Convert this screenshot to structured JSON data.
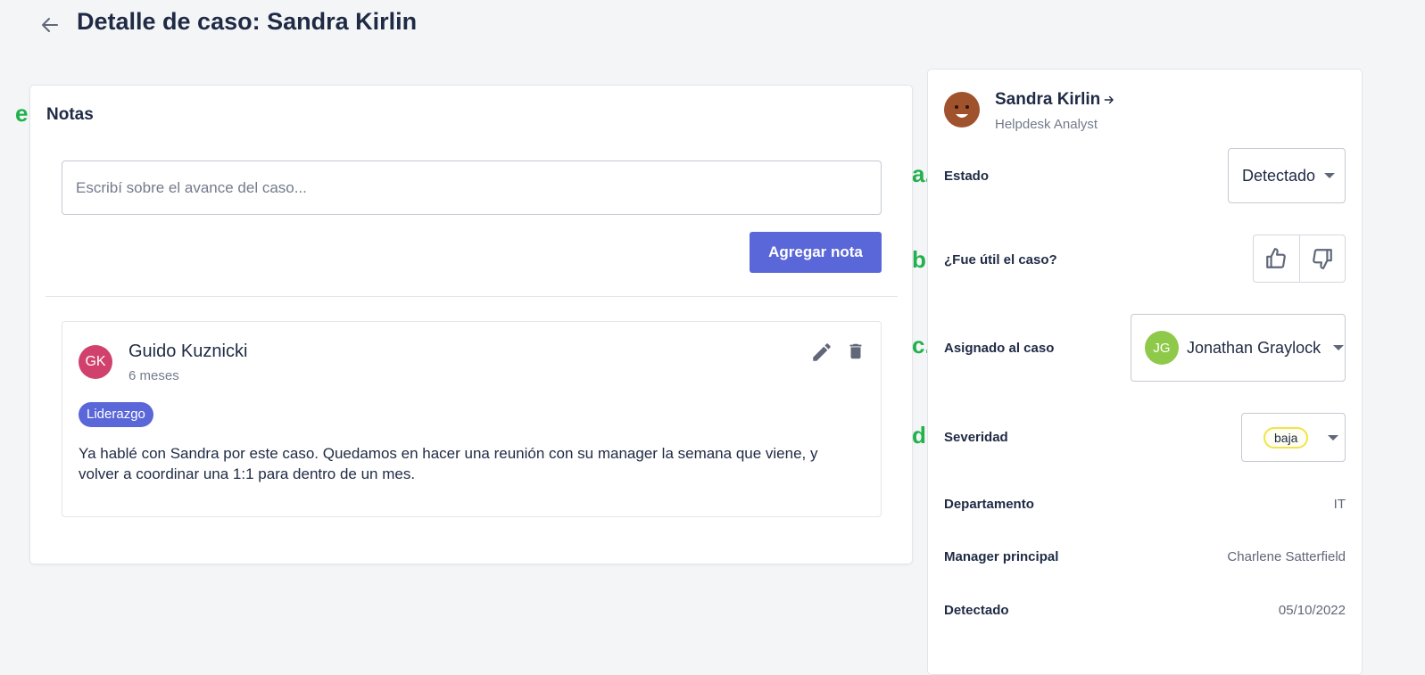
{
  "header": {
    "title": "Detalle de caso: Sandra Kirlin"
  },
  "annotations": {
    "a": "a.",
    "b": "b.",
    "c": "c.",
    "d": "d.",
    "e": "e."
  },
  "notes": {
    "title": "Notas",
    "input_placeholder": "Escribí sobre el avance del caso...",
    "add_button": "Agregar nota",
    "items": [
      {
        "initials": "GK",
        "author": "Guido Kuznicki",
        "time": "6 meses",
        "tag": "Liderazgo",
        "body": "Ya hablé con Sandra por este caso. Quedamos en hacer una reunión con su manager la semana que viene, y volver a coordinar una 1:1 para dentro de un mes."
      }
    ]
  },
  "sidebar": {
    "person": {
      "name": "Sandra Kirlin",
      "role": "Helpdesk Analyst"
    },
    "estado": {
      "label": "Estado",
      "value": "Detectado"
    },
    "util": {
      "label": "¿Fue útil el caso?"
    },
    "asignado": {
      "label": "Asignado al caso",
      "initials": "JG",
      "name": "Jonathan Graylock"
    },
    "severidad": {
      "label": "Severidad",
      "value": "baja"
    },
    "departamento": {
      "label": "Departamento",
      "value": "IT"
    },
    "manager": {
      "label": "Manager principal",
      "value": "Charlene Satterfield"
    },
    "detectado": {
      "label": "Detectado",
      "value": "05/10/2022"
    }
  },
  "colors": {
    "accent": "#5a67d8",
    "annotation": "#22b14c",
    "note_avatar": "#d0416d",
    "assignee_avatar": "#8fc94a",
    "severity_border": "#f2e34a"
  }
}
